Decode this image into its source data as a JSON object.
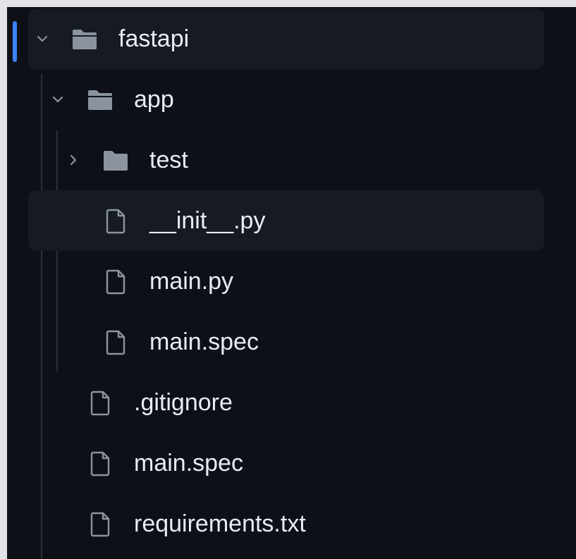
{
  "colors": {
    "background": "#0d1117",
    "row_highlight": "#161b22",
    "active_marker": "#3b82f6",
    "text": "#e6edf3",
    "icon": "#8b949e",
    "guide_line": "#2b3038"
  },
  "tree": {
    "root": {
      "name": "fastapi",
      "icon": "folder-open-icon",
      "expanded": true,
      "active": true
    },
    "app_folder": {
      "name": "app",
      "icon": "folder-open-icon",
      "expanded": true
    },
    "test_folder": {
      "name": "test",
      "icon": "folder-icon",
      "expanded": false
    },
    "app_files": [
      {
        "name": "__init__.py",
        "icon": "file-icon"
      },
      {
        "name": "main.py",
        "icon": "file-icon"
      },
      {
        "name": "main.spec",
        "icon": "file-icon"
      }
    ],
    "root_files": [
      {
        "name": ".gitignore",
        "icon": "file-icon"
      },
      {
        "name": "main.spec",
        "icon": "file-icon"
      },
      {
        "name": "requirements.txt",
        "icon": "file-icon"
      }
    ]
  }
}
